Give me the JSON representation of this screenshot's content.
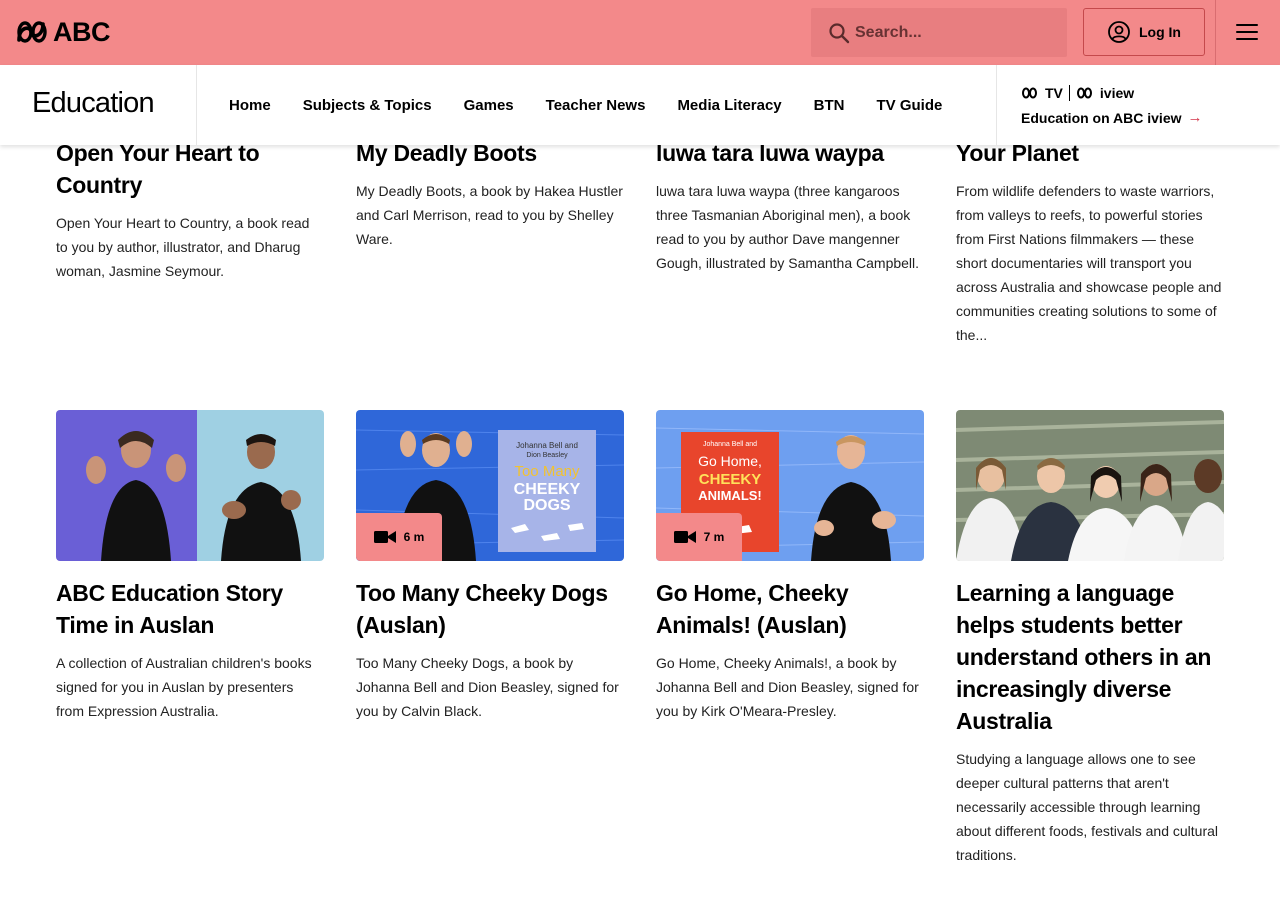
{
  "header": {
    "logo_text": "ABC",
    "search_placeholder": "Search...",
    "login_label": "Log In",
    "colors": {
      "topbar": "#f3898a",
      "accent": "#d4364a"
    }
  },
  "subnav": {
    "title": "Education",
    "links": [
      "Home",
      "Subjects & Topics",
      "Games",
      "Teacher News",
      "Media Literacy",
      "BTN",
      "TV Guide"
    ],
    "iview_logo_tv": "TV",
    "iview_logo_iview": "iview",
    "iview_link": "Education on ABC iview"
  },
  "row1": [
    {
      "title": "Open Your Heart to Country",
      "desc": "Open Your Heart to Country, a book read to you by author, illustrator, and Dharug woman, Jasmine Seymour."
    },
    {
      "title": "My Deadly Boots",
      "desc": "My Deadly Boots, a book by Hakea Hustler and Carl Merrison, read to you by Shelley Ware."
    },
    {
      "title": "luwa tara luwa waypa",
      "desc": "luwa tara luwa waypa (three kangaroos three Tasmanian Aboriginal men), a book read to you by author Dave mangenner Gough, illustrated by Samantha Campbell."
    },
    {
      "title": "Your Planet",
      "desc": "From wildlife defenders to waste warriors, from valleys to reefs, to powerful stories from First Nations filmmakers — these short documentaries will transport you across Australia and showcase people and communities creating solutions to some of the..."
    }
  ],
  "row2": [
    {
      "title": "ABC Education Story Time in Auslan",
      "desc": "A collection of Australian children's books signed for you in Auslan by presenters from Expression Australia.",
      "thumb": "auslan-presenters",
      "duration": ""
    },
    {
      "title": "Too Many Cheeky Dogs (Auslan)",
      "desc": "Too Many Cheeky Dogs, a book by Johanna Bell and Dion Beasley, signed for you by Calvin Black.",
      "thumb": "cheeky-dogs-book",
      "duration": "6 m",
      "book_title": "Too Many CHEEKY DOGS"
    },
    {
      "title": "Go Home, Cheeky Animals! (Auslan)",
      "desc": "Go Home, Cheeky Animals!, a book by Johanna Bell and Dion Beasley, signed for you by Kirk O'Meara-Presley.",
      "thumb": "cheeky-animals-book",
      "duration": "7 m",
      "book_title": "Go Home, CHEEKY ANIMALS!"
    },
    {
      "title": "Learning a language helps students better understand others in an increasingly diverse Australia",
      "desc": "Studying a language allows one to see deeper cultural patterns that aren't necessarily accessible through learning about different foods, festivals and cultural traditions.",
      "thumb": "students-photo",
      "duration": ""
    }
  ]
}
